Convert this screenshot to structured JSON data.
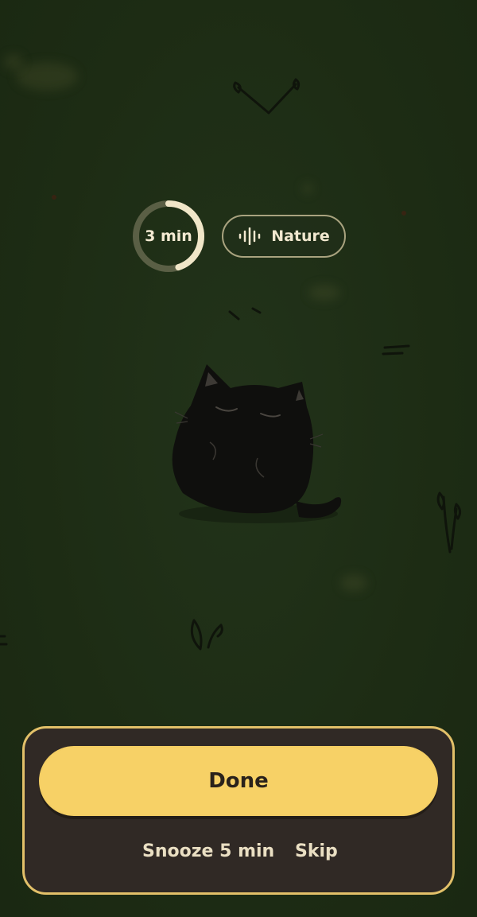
{
  "timer": {
    "label": "3 min",
    "progress": 0.45,
    "track_color": "#5a5f45",
    "fill_color": "#f0e6c8"
  },
  "sound": {
    "icon": "sound-wave-icon",
    "label": "Nature"
  },
  "actions": {
    "done_label": "Done",
    "snooze_label": "Snooze 5 min",
    "skip_label": "Skip"
  },
  "colors": {
    "background": "#1e2d15",
    "panel": "#302925",
    "panel_border": "#e2c069",
    "accent": "#f7d166"
  }
}
